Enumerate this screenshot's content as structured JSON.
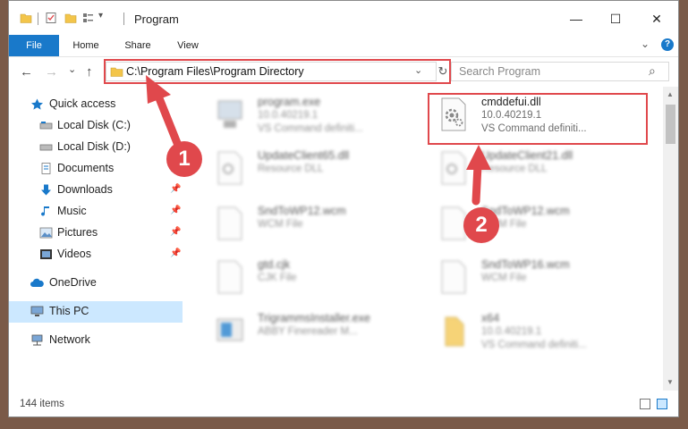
{
  "window": {
    "title": "Program",
    "controls": {
      "minimize": "—",
      "maximize": "☐",
      "close": "✕"
    }
  },
  "ribbon": {
    "tabs": [
      {
        "label": "File"
      },
      {
        "label": "Home"
      },
      {
        "label": "Share"
      },
      {
        "label": "View"
      }
    ],
    "expand": "⌄",
    "help": "?"
  },
  "navigation": {
    "back": "←",
    "forward": "→",
    "recent": "⌄",
    "up": "↑",
    "address": "C:\\Program Files\\Program Directory",
    "refresh": "↻",
    "dropdown": "⌄",
    "search_placeholder": "Search Program",
    "search_icon": "⌕"
  },
  "sidebar": {
    "items": [
      {
        "label": "Quick access",
        "icon": "star-icon"
      },
      {
        "label": "Local Disk (C:)",
        "icon": "drive-icon"
      },
      {
        "label": "Local Disk (D:)",
        "icon": "drive-icon"
      },
      {
        "label": "Documents",
        "icon": "documents-icon"
      },
      {
        "label": "Downloads",
        "icon": "downloads-icon"
      },
      {
        "label": "Music",
        "icon": "music-icon"
      },
      {
        "label": "Pictures",
        "icon": "pictures-icon"
      },
      {
        "label": "Videos",
        "icon": "videos-icon"
      },
      {
        "label": "OneDrive",
        "icon": "cloud-icon"
      },
      {
        "label": "This PC",
        "icon": "computer-icon"
      },
      {
        "label": "Network",
        "icon": "network-icon"
      }
    ],
    "pin_glyph": "📌"
  },
  "files": [
    {
      "name": "program.exe",
      "meta1": "10.0.40219.1",
      "meta2": "VS Command definiti..."
    },
    {
      "name": "cmddefui.dll",
      "meta1": "10.0.40219.1",
      "meta2": "VS Command definiti..."
    },
    {
      "name": "UpdateClient65.dll",
      "meta1": "Resource DLL"
    },
    {
      "name": "UpdateClient21.dll",
      "meta1": "Resource DLL"
    },
    {
      "name": "SndToWP12.wcm",
      "meta1": "WCM File"
    },
    {
      "name": "SndToWP12.wcm",
      "meta1": "WCM File"
    },
    {
      "name": "gtd.cjk",
      "meta1": "CJK File"
    },
    {
      "name": "SndToWP16.wcm",
      "meta1": "WCM File"
    },
    {
      "name": "TrigrammsInstaller.exe",
      "meta1": "ABBY Finereader M..."
    },
    {
      "name": "x64",
      "meta1": "10.0.40219.1",
      "meta2": "VS Command definiti..."
    }
  ],
  "status": {
    "item_count": "144 items"
  },
  "callouts": {
    "one": "1",
    "two": "2"
  },
  "colors": {
    "accent": "#1979ca",
    "highlight": "#e0484c",
    "selected": "#cce8ff",
    "folder": "#f3c54a"
  }
}
